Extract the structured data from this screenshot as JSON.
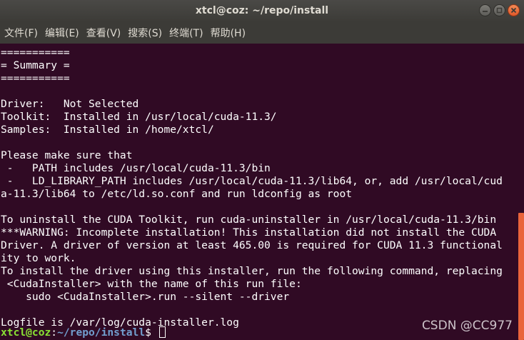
{
  "window": {
    "title": "xtcl@coz: ~/repo/install"
  },
  "menu": [
    "文件(F)",
    "编辑(E)",
    "查看(V)",
    "搜索(S)",
    "终端(T)",
    "帮助(H)"
  ],
  "terminal": {
    "lines": [
      "===========",
      "= Summary =",
      "===========",
      "",
      "Driver:   Not Selected",
      "Toolkit:  Installed in /usr/local/cuda-11.3/",
      "Samples:  Installed in /home/xtcl/",
      "",
      "Please make sure that",
      " -   PATH includes /usr/local/cuda-11.3/bin",
      " -   LD_LIBRARY_PATH includes /usr/local/cuda-11.3/lib64, or, add /usr/local/cud",
      "a-11.3/lib64 to /etc/ld.so.conf and run ldconfig as root",
      "",
      "To uninstall the CUDA Toolkit, run cuda-uninstaller in /usr/local/cuda-11.3/bin",
      "***WARNING: Incomplete installation! This installation did not install the CUDA",
      "Driver. A driver of version at least 465.00 is required for CUDA 11.3 functional",
      "ity to work.",
      "To install the driver using this installer, run the following command, replacing",
      " <CudaInstaller> with the name of this run file:",
      "    sudo <CudaInstaller>.run --silent --driver",
      "",
      "Logfile is /var/log/cuda-installer.log"
    ],
    "prompt": {
      "user_host": "xtcl@coz",
      "sep": ":",
      "path": "~/repo/install",
      "symbol": "$ "
    }
  },
  "watermark": "CSDN @CC977",
  "colors": {
    "background": "#300a24",
    "prompt_user": "#8ae234",
    "prompt_path": "#729fcf",
    "scrollbar": "#e9643b"
  }
}
